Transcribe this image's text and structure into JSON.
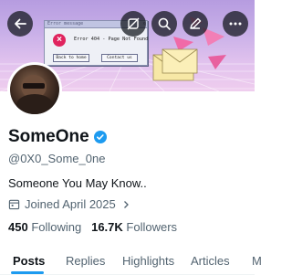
{
  "banner": {
    "error_window": {
      "title": "Error message",
      "close": "x",
      "message": "Error 404 - Page Not Found",
      "back_button": "Back to home",
      "contact_button": "Contact us"
    }
  },
  "header_icons": [
    "back-arrow-icon",
    "no-image-icon",
    "search-icon",
    "edit-icon",
    "more-icon"
  ],
  "profile": {
    "name": "SomeOne",
    "verified": "verified-badge-icon",
    "handle": "@0X0_Some_0ne",
    "bio": "Someone You May Know..",
    "joined": "Joined April 2025",
    "following_count": "450",
    "following_label": "Following",
    "followers_count": "16.7K",
    "followers_label": "Followers"
  },
  "tabs": [
    {
      "label": "Posts",
      "active": true
    },
    {
      "label": "Replies",
      "active": false
    },
    {
      "label": "Highlights",
      "active": false
    },
    {
      "label": "Articles",
      "active": false
    },
    {
      "label": "M",
      "active": false
    }
  ],
  "colors": {
    "accent": "#1d9bf0",
    "text_primary": "#0f1419",
    "text_secondary": "#536471",
    "error_red": "#e0245e"
  }
}
